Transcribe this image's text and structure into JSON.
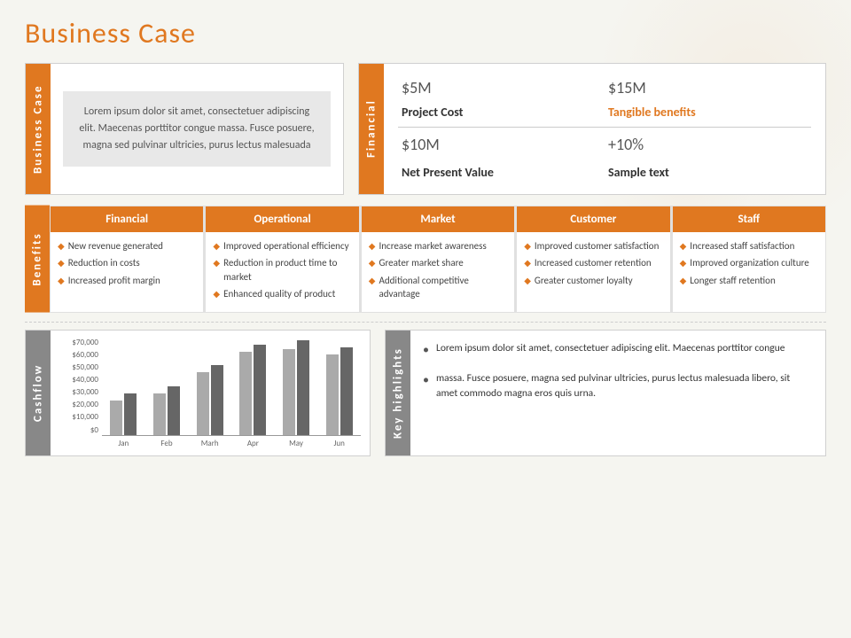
{
  "title": "Business Case",
  "topRow": {
    "businessCase": {
      "label": "Business Case",
      "text": "Lorem ipsum dolor sit amet, consectetuer adipiscing elit. Maecenas porttitor congue massa. Fusce posuere, magna sed pulvinar ultricies, purus lectus malesuada"
    },
    "financial": {
      "label": "Financial",
      "topLeft": "$5M",
      "topRight": "$15M",
      "midLeft": "Project Cost",
      "midRight": "Tangible benefits",
      "botLeft": "$10M",
      "botRight": "+10%",
      "botLabelLeft": "Net Present Value",
      "botLabelRight": "Sample text"
    }
  },
  "benefits": {
    "label": "Benefits",
    "columns": [
      {
        "header": "Financial",
        "items": [
          "New revenue generated",
          "Reduction in costs",
          "Increased profit margin"
        ]
      },
      {
        "header": "Operational",
        "items": [
          "Improved operational efficiency",
          "Reduction in product time to market",
          "Enhanced quality of product"
        ]
      },
      {
        "header": "Market",
        "items": [
          "Increase market awareness",
          "Greater market share",
          "Additional competitive advantage"
        ]
      },
      {
        "header": "Customer",
        "items": [
          "Improved customer satisfaction",
          "Increased customer retention",
          "Greater customer loyalty"
        ]
      },
      {
        "header": "Staff",
        "items": [
          "Increased staff satisfaction",
          "Improved organization culture",
          "Longer staff retention"
        ]
      }
    ]
  },
  "cashflow": {
    "label": "Cashflow",
    "yLabels": [
      "$70,000",
      "$60,000",
      "$50,000",
      "$40,000",
      "$30,000",
      "$20,000",
      "$10,000",
      "$0"
    ],
    "xLabels": [
      "Jan",
      "Feb",
      "Marh",
      "Apr",
      "May",
      "Jun"
    ],
    "bars": [
      {
        "light": 25,
        "dark": 30
      },
      {
        "light": 30,
        "dark": 35
      },
      {
        "light": 45,
        "dark": 50
      },
      {
        "light": 60,
        "dark": 65
      },
      {
        "light": 62,
        "dark": 68
      },
      {
        "light": 58,
        "dark": 63
      }
    ]
  },
  "keyHighlights": {
    "label": "Key highlights",
    "items": [
      "Lorem ipsum dolor sit amet, consectetuer adipiscing elit. Maecenas porttitor congue",
      "massa. Fusce posuere, magna sed pulvinar ultricies, purus lectus malesuada libero, sit amet commodo magna eros quis urna."
    ]
  }
}
